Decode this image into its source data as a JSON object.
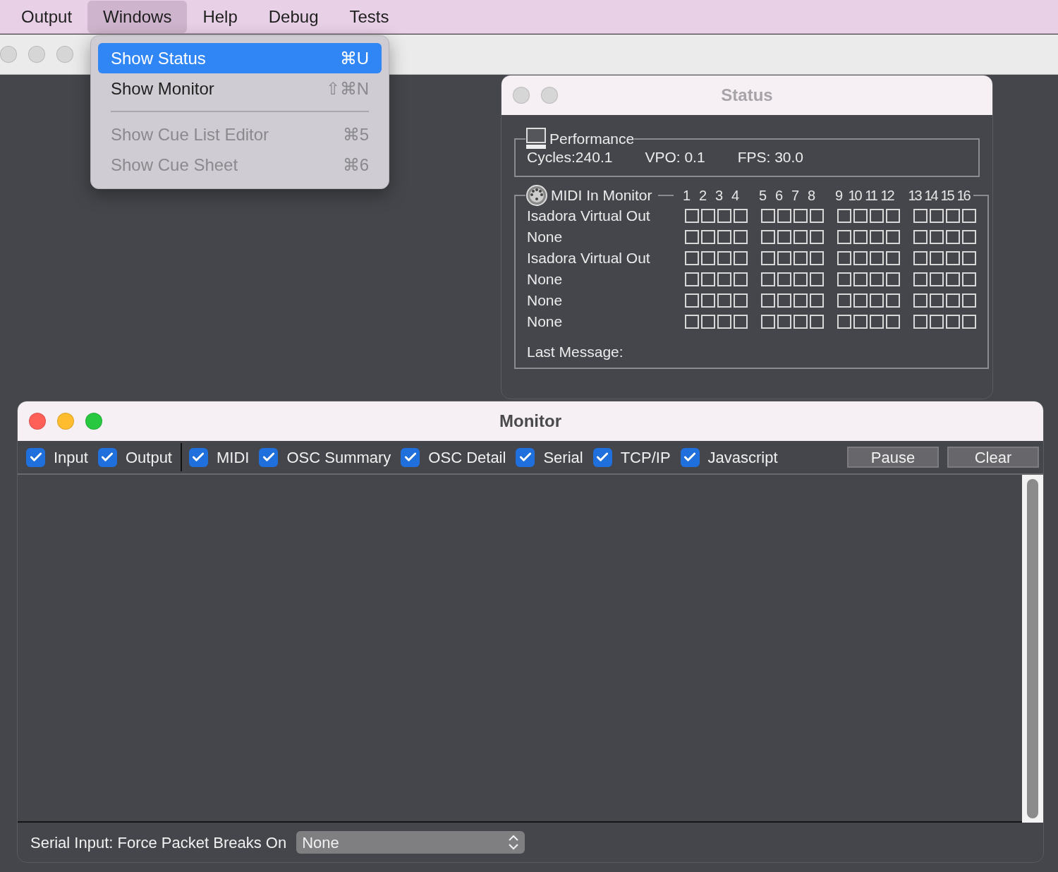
{
  "menu_bar": {
    "items": [
      {
        "label": "Output",
        "selected": false
      },
      {
        "label": "Windows",
        "selected": true
      },
      {
        "label": "Help",
        "selected": false
      },
      {
        "label": "Debug",
        "selected": false
      },
      {
        "label": "Tests",
        "selected": false
      }
    ]
  },
  "menu": {
    "items": [
      {
        "kind": "item",
        "label": "Show Status",
        "shortcut": "⌘U",
        "selected": true,
        "disabled": false
      },
      {
        "kind": "item",
        "label": "Show Monitor",
        "shortcut": "⇧⌘N",
        "selected": false,
        "disabled": false
      },
      {
        "kind": "separator"
      },
      {
        "kind": "item",
        "label": "Show Cue List Editor",
        "shortcut": "⌘5",
        "selected": false,
        "disabled": true
      },
      {
        "kind": "item",
        "label": "Show Cue Sheet",
        "shortcut": "⌘6",
        "selected": false,
        "disabled": true
      }
    ]
  },
  "status_window": {
    "title": "Status",
    "performance": {
      "title": "Performance",
      "stats": [
        "Cycles:240.1",
        "VPO: 0.1",
        "FPS: 30.0"
      ]
    },
    "midi_monitor": {
      "title": "MIDI In Monitor",
      "channels": [
        "1",
        "2",
        "3",
        "4",
        "5",
        "6",
        "7",
        "8",
        "9",
        "10",
        "11",
        "12",
        "13",
        "14",
        "15",
        "16"
      ],
      "rows": [
        {
          "name": "Isadora Virtual Out"
        },
        {
          "name": "None"
        },
        {
          "name": "Isadora Virtual Out"
        },
        {
          "name": "None"
        },
        {
          "name": "None"
        },
        {
          "name": "None"
        }
      ],
      "last_message_label": "Last Message:"
    }
  },
  "monitor_window": {
    "title": "Monitor",
    "filter_groups": [
      [
        {
          "label": "Input",
          "checked": true
        },
        {
          "label": "Output",
          "checked": true
        }
      ],
      [
        {
          "label": "MIDI",
          "checked": true
        },
        {
          "label": "OSC Summary",
          "checked": true
        },
        {
          "label": "OSC Detail",
          "checked": true
        },
        {
          "label": "Serial",
          "checked": true
        },
        {
          "label": "TCP/IP",
          "checked": true
        },
        {
          "label": "Javascript",
          "checked": true
        }
      ]
    ],
    "buttons": [
      "Pause",
      "Clear"
    ],
    "serial_label": "Serial Input: Force Packet Breaks On",
    "serial_select": {
      "value": "None"
    }
  }
}
